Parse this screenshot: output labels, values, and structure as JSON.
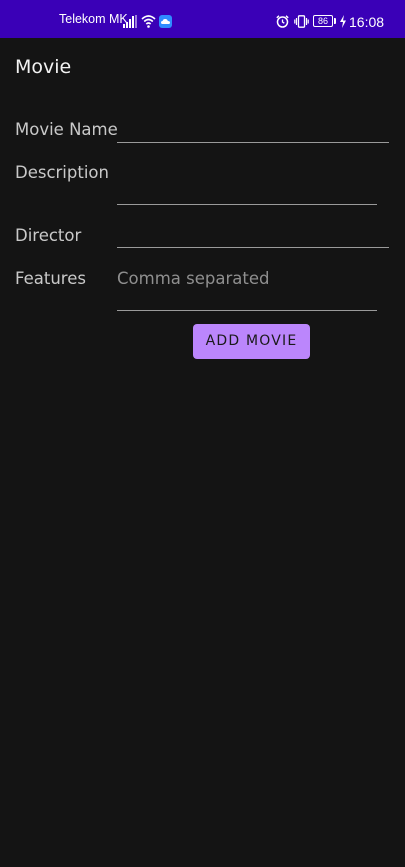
{
  "status_bar": {
    "carrier": "Telekom MK",
    "battery": "86",
    "time": "16:08",
    "icons": [
      "signal-icon",
      "wifi-icon",
      "cloud-icon",
      "alarm-icon",
      "vibrate-icon",
      "battery-icon",
      "charging-icon"
    ]
  },
  "app_bar": {
    "title": "Movie"
  },
  "form": {
    "movie_name_label": "Movie Name",
    "movie_name_value": "",
    "description_label": "Description",
    "description_value": "",
    "director_label": "Director",
    "director_value": "",
    "features_label": "Features",
    "features_placeholder": "Comma separated",
    "features_value": ""
  },
  "actions": {
    "add_label": "ADD MOVIE"
  },
  "colors": {
    "status_bar_bg": "#3a00b7",
    "background": "#141414",
    "button_bg": "#bb86fc"
  }
}
